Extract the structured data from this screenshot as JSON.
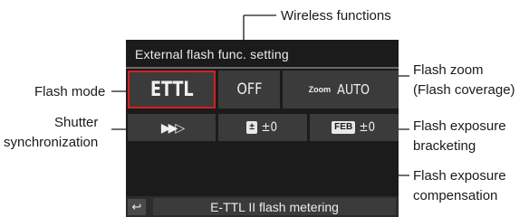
{
  "screen": {
    "title": "External flash func. setting",
    "flash_mode": "ETTL",
    "wireless": "OFF",
    "zoom_prefix": "Zoom",
    "zoom_value": "AUTO",
    "shutter_sync_icon": "second-curtain-sync-icon",
    "shutter_sync_glyph": "▶▶▷",
    "fec_icon_text": "±",
    "fec_value": "±0",
    "feb_icon_text": "FEB",
    "feb_value": "±0",
    "back_glyph": "↩",
    "bottom_text": "E-TTL II flash metering"
  },
  "callouts": {
    "wireless": "Wireless functions",
    "flash_mode": "Flash mode",
    "zoom_line1": "Flash zoom",
    "zoom_line2": "(Flash coverage)",
    "shutter_line1": "Shutter",
    "shutter_line2": "synchronization",
    "feb_line1": "Flash exposure",
    "feb_line2": "bracketing",
    "fec_line1": "Flash exposure",
    "fec_line2": "compensation"
  }
}
